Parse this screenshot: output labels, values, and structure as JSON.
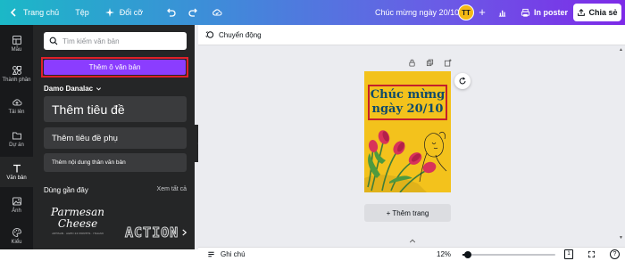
{
  "topbar": {
    "home": "Trang chủ",
    "file": "Tệp",
    "resize": "Đổi cỡ",
    "doc_title": "Chúc mừng ngày 20/10",
    "avatar_initials": "TT",
    "plus": "+",
    "print": "In poster",
    "share": "Chia sẻ",
    "accent_start": "#1bb8c7",
    "accent_end": "#7d2ae8"
  },
  "rail": {
    "items": [
      {
        "label": "Mẫu",
        "icon": "template-icon"
      },
      {
        "label": "Thành phần",
        "icon": "elements-icon"
      },
      {
        "label": "Tải lên",
        "icon": "upload-icon"
      },
      {
        "label": "Dự án",
        "icon": "folder-icon"
      },
      {
        "label": "Văn bản",
        "icon": "text-icon"
      },
      {
        "label": "Ảnh",
        "icon": "photo-icon"
      },
      {
        "label": "Kiểu",
        "icon": "styles-icon"
      }
    ],
    "active_index": 4
  },
  "panel": {
    "search_placeholder": "Tìm kiếm văn bản",
    "add_text": "Thêm ô văn bản",
    "font_kit": "Damo Danalac",
    "heading": "Thêm tiêu đề",
    "subheading": "Thêm tiêu đề phụ",
    "body": "Thêm nội dung thân văn bản",
    "recent": "Dùng gần đây",
    "see_all": "Xem tất cả",
    "recent_items": {
      "parmesan_line1": "Parmesan",
      "parmesan_line2": "Cheese",
      "parmesan_fine": "ARTISAN · AGED 24 MONTHS · ITALIAN",
      "action": "ACTION"
    },
    "button_color": "#8b3dff",
    "highlight_color": "#e0202a"
  },
  "context_bar": {
    "animate": "Chuyển động"
  },
  "canvas": {
    "poster_line1": "Chúc mừng",
    "poster_line2": "ngày 20/10",
    "poster_bg": "#f3c21c",
    "add_page": "+ Thêm trang"
  },
  "bottombar": {
    "notes": "Ghi chú",
    "zoom": "12%",
    "zoom_fraction": 0.06,
    "page_count": "1",
    "help": "?"
  }
}
